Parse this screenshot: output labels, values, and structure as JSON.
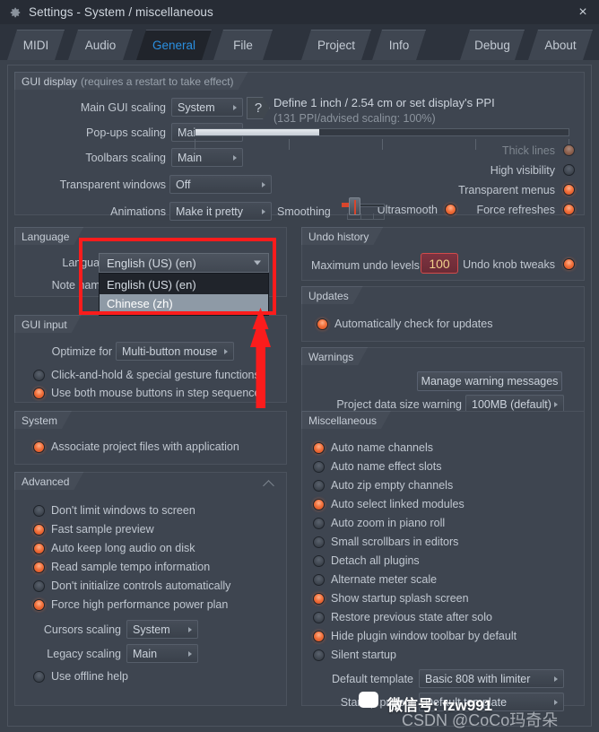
{
  "window": {
    "title": "Settings - System / miscellaneous",
    "gear_icon": "gear-icon",
    "close_icon": "×"
  },
  "tabs": [
    {
      "label": "MIDI",
      "active": false
    },
    {
      "label": "Audio",
      "active": false
    },
    {
      "label": "General",
      "active": true
    },
    {
      "label": "File",
      "active": false
    },
    {
      "label": "Project",
      "active": false
    },
    {
      "label": "Info",
      "active": false
    },
    {
      "label": "Debug",
      "active": false
    },
    {
      "label": "About",
      "active": false
    }
  ],
  "gui_display": {
    "title": "GUI display",
    "title_note": "(requires a restart to take effect)",
    "main_gui_scaling_label": "Main GUI scaling",
    "main_gui_scaling_value": "System",
    "popups_scaling_label": "Pop-ups scaling",
    "popups_scaling_value": "Main",
    "toolbars_scaling_label": "Toolbars scaling",
    "toolbars_scaling_value": "Main",
    "transparent_windows_label": "Transparent windows",
    "transparent_windows_value": "Off",
    "animations_label": "Animations",
    "animations_value": "Make it pretty",
    "help_button": "?",
    "ppi_line1": "Define 1 inch / 2.54 cm or set display's PPI",
    "ppi_line2": "(131 PPI/advised scaling: 100%)",
    "smoothing_label": "Smoothing",
    "toggles": [
      {
        "label": "Thick lines",
        "state": "dimon"
      },
      {
        "label": "High visibility",
        "state": "off"
      },
      {
        "label": "Transparent menus",
        "state": "on"
      },
      {
        "label": "Ultrasmooth",
        "state": "on"
      },
      {
        "label": "Force refreshes",
        "state": "on"
      }
    ]
  },
  "language": {
    "title": "Language",
    "language_label": "Language",
    "note_names_label": "Note names",
    "selected": "English (US) (en)",
    "options": [
      {
        "label": "English (US) (en)",
        "selected": false
      },
      {
        "label": "Chinese (zh)",
        "selected": true
      }
    ]
  },
  "gui_input": {
    "title": "GUI input",
    "optimize_label": "Optimize for",
    "optimize_value": "Multi-button mouse",
    "options": [
      {
        "label": "Click-and-hold & special gesture functions",
        "state": "off"
      },
      {
        "label": "Use both mouse buttons in step sequencer",
        "state": "on"
      }
    ]
  },
  "system": {
    "title": "System",
    "options": [
      {
        "label": "Associate project files with application",
        "state": "on"
      }
    ]
  },
  "advanced": {
    "title": "Advanced",
    "collapse_icon": "chevron-up-icon",
    "options": [
      {
        "label": "Don't limit windows to screen",
        "state": "off"
      },
      {
        "label": "Fast sample preview",
        "state": "on"
      },
      {
        "label": "Auto keep long audio on disk",
        "state": "on"
      },
      {
        "label": "Read sample tempo information",
        "state": "on"
      },
      {
        "label": "Don't initialize controls automatically",
        "state": "off"
      },
      {
        "label": "Force high performance power plan",
        "state": "on"
      }
    ],
    "cursors_scaling_label": "Cursors scaling",
    "cursors_scaling_value": "System",
    "legacy_scaling_label": "Legacy scaling",
    "legacy_scaling_value": "Main",
    "offline_help": {
      "label": "Use offline help",
      "state": "off"
    }
  },
  "undo_history": {
    "title": "Undo history",
    "max_levels_label": "Maximum undo levels",
    "max_levels_value": "100",
    "knob_tweaks_label": "Undo knob tweaks",
    "knob_tweaks_state": "on"
  },
  "updates": {
    "title": "Updates",
    "auto_check_label": "Automatically check for updates",
    "auto_check_state": "on"
  },
  "warnings": {
    "title": "Warnings",
    "manage_button": "Manage warning messages",
    "project_size_label": "Project data size warning",
    "project_size_value": "100MB (default)"
  },
  "miscellaneous": {
    "title": "Miscellaneous",
    "options": [
      {
        "label": "Auto name channels",
        "state": "on"
      },
      {
        "label": "Auto name effect slots",
        "state": "off"
      },
      {
        "label": "Auto zip empty channels",
        "state": "off"
      },
      {
        "label": "Auto select linked modules",
        "state": "on"
      },
      {
        "label": "Auto zoom in piano roll",
        "state": "off"
      },
      {
        "label": "Small scrollbars in editors",
        "state": "off"
      },
      {
        "label": "Detach all plugins",
        "state": "off"
      },
      {
        "label": "Alternate meter scale",
        "state": "off"
      },
      {
        "label": "Show startup splash screen",
        "state": "on"
      },
      {
        "label": "Restore previous state after solo",
        "state": "off"
      },
      {
        "label": "Hide plugin window toolbar by default",
        "state": "on"
      },
      {
        "label": "Silent startup",
        "state": "off"
      }
    ],
    "default_template_label": "Default template",
    "default_template_value": "Basic 808 with limiter",
    "startup_project_label": "Startup project",
    "startup_project_value": "Default template"
  },
  "watermark": {
    "wechat": "微信号: fzw991",
    "csdn": "CSDN @CoCo玛奇朵"
  }
}
